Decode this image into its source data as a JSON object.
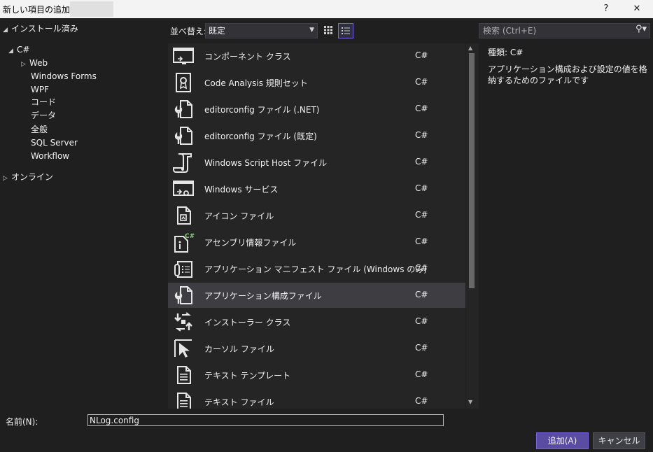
{
  "window": {
    "title": "新しい項目の追加 -",
    "help": "?",
    "close": "✕"
  },
  "tree": {
    "installed": "インストール済み",
    "csharp": "C#",
    "children": [
      "Web",
      "Windows Forms",
      "WPF",
      "コード",
      "データ",
      "全般",
      "SQL Server",
      "Workflow"
    ],
    "online": "オンライン"
  },
  "toolbar": {
    "sort_label": "並べ替え:",
    "sort_value": "既定"
  },
  "search": {
    "placeholder": "検索 (Ctrl+E)"
  },
  "items": [
    {
      "name": "コンポーネント クラス",
      "lang": "C#",
      "icon": "component-class-icon"
    },
    {
      "name": "Code Analysis 規則セット",
      "lang": "C#",
      "icon": "ruleset-icon"
    },
    {
      "name": "editorconfig ファイル (.NET)",
      "lang": "C#",
      "icon": "config-file-icon"
    },
    {
      "name": "editorconfig ファイル (既定)",
      "lang": "C#",
      "icon": "config-file-icon"
    },
    {
      "name": "Windows Script Host ファイル",
      "lang": "C#",
      "icon": "script-file-icon"
    },
    {
      "name": "Windows サービス",
      "lang": "C#",
      "icon": "windows-service-icon"
    },
    {
      "name": "アイコン ファイル",
      "lang": "C#",
      "icon": "icon-file-icon"
    },
    {
      "name": "アセンブリ情報ファイル",
      "lang": "C#",
      "icon": "assembly-info-icon"
    },
    {
      "name": "アプリケーション マニフェスト ファイル (Windows のみ)",
      "lang": "C#",
      "icon": "manifest-file-icon"
    },
    {
      "name": "アプリケーション構成ファイル",
      "lang": "C#",
      "icon": "config-file-icon"
    },
    {
      "name": "インストーラー クラス",
      "lang": "C#",
      "icon": "installer-class-icon"
    },
    {
      "name": "カーソル ファイル",
      "lang": "C#",
      "icon": "cursor-file-icon"
    },
    {
      "name": "テキスト テンプレート",
      "lang": "C#",
      "icon": "text-template-icon"
    },
    {
      "name": "テキスト ファイル",
      "lang": "C#",
      "icon": "text-file-icon"
    }
  ],
  "selected_index": 9,
  "details": {
    "type_label": "種類:",
    "type_value": "C#",
    "description": "アプリケーション構成および設定の値を格納するためのファイルです"
  },
  "name_field": {
    "label": "名前(N):",
    "value": "NLog.config"
  },
  "buttons": {
    "add": "追加(A)",
    "cancel": "キャンセル"
  },
  "colors": {
    "accent": "#7a66e0",
    "primary_button": "#5a4ba3",
    "csharp_badge": "#7fd26b"
  }
}
